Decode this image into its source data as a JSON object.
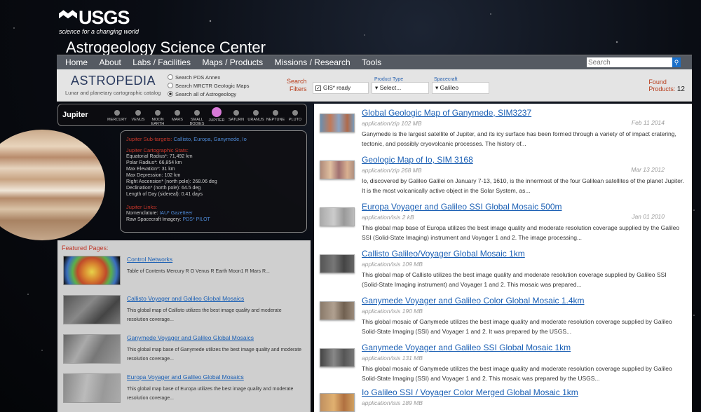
{
  "header": {
    "logo": "USGS",
    "tagline": "science for a changing world",
    "site_title": "Astrogeology Science Center"
  },
  "nav": {
    "items": [
      "Home",
      "About",
      "Labs / Facilities",
      "Maps / Products",
      "Missions / Research",
      "Tools"
    ],
    "search_placeholder": "Search"
  },
  "filters": {
    "astropedia_title": "ASTROPEDIA",
    "astropedia_sub": "Lunar and planetary cartographic catalog",
    "radios": [
      "Search PDS Annex",
      "Search MRCTR GeoIogic Maps",
      "Search all of Astrogeology"
    ],
    "selected_radio": 2,
    "search_filters_line1": "Search",
    "search_filters_line2": "Filters",
    "gis_label": "GIS* ready",
    "product_type_label": "Product Type",
    "product_type_value": "Select...",
    "spacecraft_label": "Spacecraft",
    "spacecraft_value": "Galileo",
    "found_line1": "Found",
    "found_line2": "Products:",
    "found_count": "12"
  },
  "planets": {
    "title": "Jupiter",
    "items": [
      "MERCURY",
      "VENUS",
      "MOON EARTH",
      "MARS",
      "SMALL BODIES",
      "JUPITER",
      "SATURN",
      "URANUS",
      "NEPTUNE",
      "PLUTO"
    ],
    "active": "JUPITER"
  },
  "info": {
    "subtargets_label": "Jupiter Sub-targets:",
    "subtargets": "Callisto, Europa, Ganymede, Io",
    "stats_label": "Jupiter Cartographic Stats:",
    "stats": [
      "Equatorial Radius*: 71,492 km",
      "Polar Radius*: 66,854 km",
      "Max Elevation*: 31 km",
      "Max Depression: 102 km",
      "Right Ascension* (north pole): 268.06 deg",
      "Declination* (north pole): 64.5 deg",
      "Length of Day (sidereal): 0.41 days"
    ],
    "links_label": "Jupiter Links:",
    "nomenclature_label": "Nomenclature:",
    "nomenclature_links": "IAU* Gazetteer",
    "raw_label": "Raw Spacecraft Imagery:",
    "raw_links": "PDS* PILOT"
  },
  "featured": {
    "title": "Featured Pages:",
    "items": [
      {
        "title": "Control Networks",
        "desc": "Table of Contents Mercury R O Venus R Earth   Moon1 R Mars R..."
      },
      {
        "title": "Callisto Voyager and Galileo Global Mosaics",
        "desc": "This global map of Callisto utilizes the best image quality and moderate resolution coverage..."
      },
      {
        "title": "Ganymede Voyager and Galileo Global Mosaics",
        "desc": "This global map base of Ganymede utilizes the best image quality and moderate resolution coverage..."
      },
      {
        "title": "Europa Voyager and Galileo Global Mosaics",
        "desc": "This global map base of Europa utilizes the best image quality and moderate resolution coverage..."
      }
    ]
  },
  "results": [
    {
      "title": "Global Geologic Map of Ganymede, SIM3237",
      "meta": "application/zip 102 MB",
      "date": "Feb 11 2014",
      "desc": "Ganymede is the largest satellite of Jupiter, and its icy surface has been formed through a variety of of impact cratering, tectonic, and possibly cryovolcanic processes. The history of..."
    },
    {
      "title": "Geologic Map of Io, SIM 3168",
      "meta": "application/zip 268 MB",
      "date": "Mar 13 2012",
      "desc": "Io, discovered by Galileo Galilei on January 7-13, 1610, is the innermost of the four Galilean satellites of the planet Jupiter. It is the most volcanically active object in the Solar System, as..."
    },
    {
      "title": "Europa Voyager and Galileo SSI Global Mosaic 500m",
      "meta": "application/isis 2 kB",
      "date": "Jan 01 2010",
      "desc": "This global map base of Europa utilizes the best image quality and moderate resolution coverage supplied by the Galileo SSI (Solid-State Imaging) instrument and Voyager 1 and 2. The image processing..."
    },
    {
      "title": "Callisto Galileo/Voyager Global Mosaic 1km",
      "meta": "application/isis 109 MB",
      "date": "",
      "desc": "This global map of Callisto utilizes the best image quality and moderate resolution coverage supplied by Galileo SSI (Solid-State Imaging instrument) and Voyager 1 and 2. This mosaic was prepared..."
    },
    {
      "title": "Ganymede Voyager and Galileo Color Global Mosaic 1.4km",
      "meta": "application/isis 190 MB",
      "date": "",
      "desc": "This global mosaic of Ganymede utilizes the best image quality and moderate resolution coverage supplied by Galileo Solid-State Imaging (SSI) and Voyager 1 and 2. It was prepared by the USGS..."
    },
    {
      "title": "Ganymede Voyager and Galileo SSI Global Mosaic 1km",
      "meta": "application/isis 131 MB",
      "date": "",
      "desc": "This global mosaic of Ganymede utilizes the best image quality and moderate resolution coverage supplied by Galileo Solid-State Imaging (SSI) and Voyager 1 and 2. This mosaic was prepared by the USGS..."
    },
    {
      "title": "Io Galileo SSI / Voyager Color Merged Global Mosaic 1km",
      "meta": "application/isis 189 MB",
      "date": "",
      "desc": ""
    }
  ]
}
